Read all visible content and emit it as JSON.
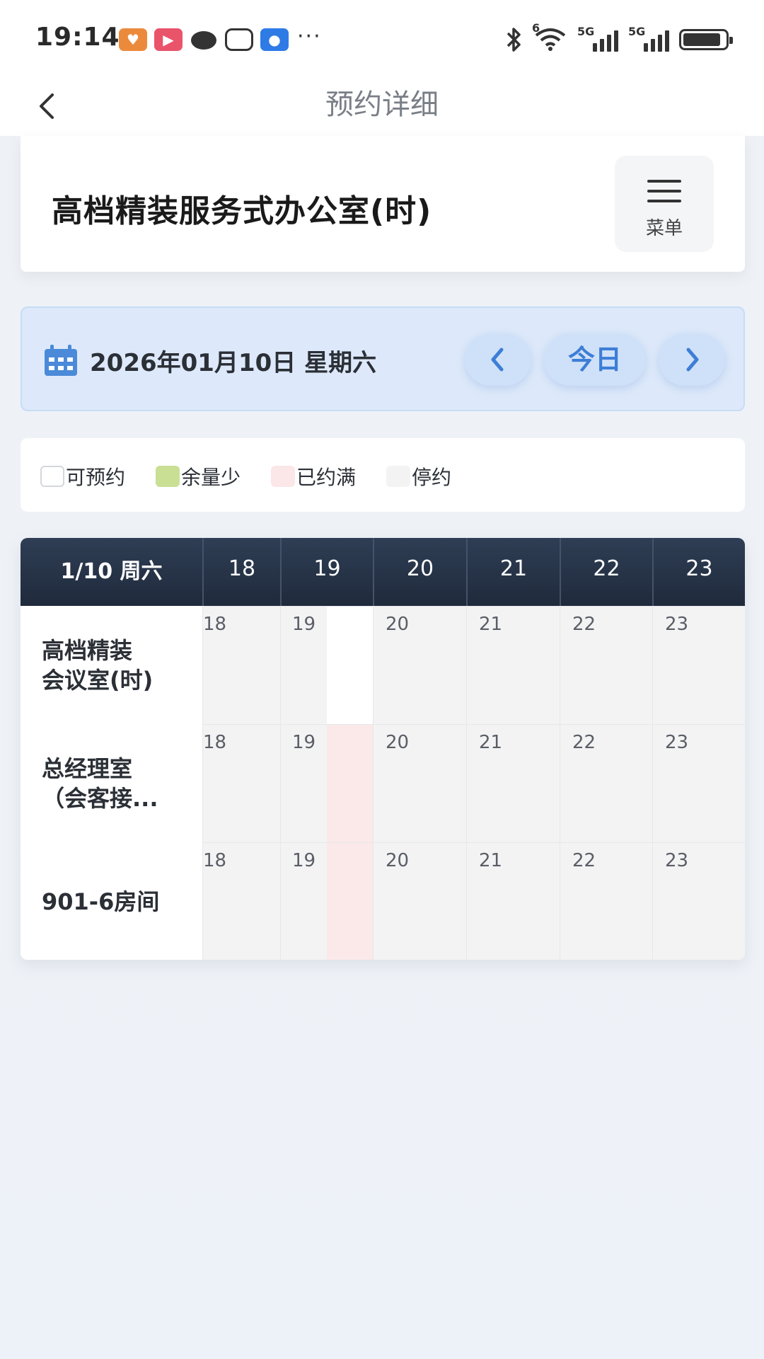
{
  "status_bar": {
    "time": "19:14",
    "more": "···",
    "wifi_badge": "6",
    "signal1_label": "5G",
    "signal2_label": "5G"
  },
  "header": {
    "title": "预约详细"
  },
  "room": {
    "name": "高档精装服务式办公室(时)",
    "menu_label": "菜单"
  },
  "date_bar": {
    "date_text": "2026年01月10日 星期六",
    "today_label": "今日"
  },
  "legend": [
    {
      "label": "可预约",
      "color": "#ffffff"
    },
    {
      "label": "余量少",
      "color": "#c9df94"
    },
    {
      "label": "已约满",
      "color": "#fbe7e7"
    },
    {
      "label": "停约",
      "color": "#f3f3f4"
    }
  ],
  "schedule": {
    "header_date": "1/10 周六",
    "hours": [
      "18",
      "19",
      "20",
      "21",
      "22",
      "23"
    ],
    "rows": [
      {
        "label_line1": "高档精装",
        "label_line2": "会议室(时)",
        "cells": [
          "18",
          "19",
          "20",
          "21",
          "22",
          "23"
        ]
      },
      {
        "label_line1": "总经理室",
        "label_line2": "（会客接...",
        "cells": [
          "18",
          "19",
          "20",
          "21",
          "22",
          "23"
        ]
      },
      {
        "label_line1": "901-6房间",
        "label_line2": "",
        "cells": [
          "18",
          "19",
          "20",
          "21",
          "22",
          "23"
        ]
      }
    ],
    "colors": {
      "free": "#ffffff",
      "full": "#fbe9e9",
      "stopped": "#f3f3f4"
    }
  }
}
